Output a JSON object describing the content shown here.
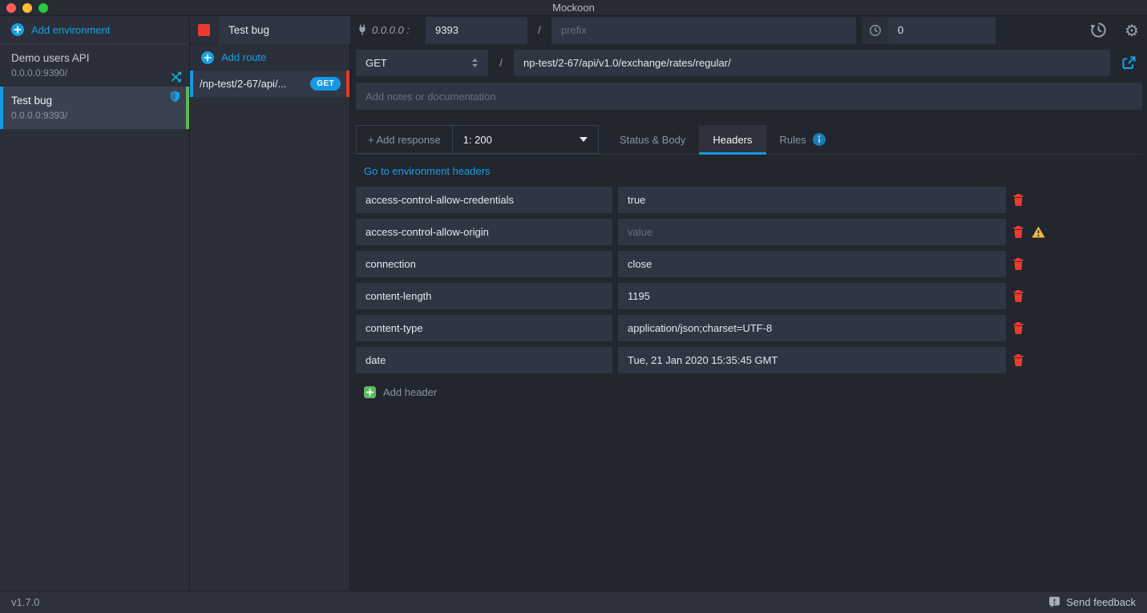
{
  "titlebar": {
    "title": "Mockoon"
  },
  "env_sidebar": {
    "add_environment_label": "Add environment",
    "items": [
      {
        "name": "Demo users API",
        "url": "0.0.0.0:9390/",
        "selected": false,
        "proxy_mode": true
      },
      {
        "name": "Test bug",
        "url": "0.0.0.0:9393/",
        "selected": true,
        "https": true,
        "running": true
      }
    ]
  },
  "routes_panel": {
    "environment_name": "Test bug",
    "add_route_label": "Add route",
    "route": {
      "path": "/np-test/2-67/api/...",
      "method": "GET",
      "selected": true
    }
  },
  "env_toolbar": {
    "host_label": "0.0.0.0 :",
    "port": "9393",
    "separator": "/",
    "prefix_placeholder": "prefix",
    "latency": "0"
  },
  "route_config": {
    "method": "GET",
    "separator": "/",
    "endpoint": "np-test/2-67/api/v1.0/exchange/rates/regular/",
    "notes_placeholder": "Add notes or documentation"
  },
  "response_section": {
    "add_response_label": "+ Add response",
    "selected_response": "1: 200",
    "tabs": [
      {
        "label": "Status & Body",
        "active": false
      },
      {
        "label": "Headers",
        "active": true
      },
      {
        "label": "Rules",
        "active": false,
        "has_info_icon": true
      }
    ],
    "go_to_env_headers_label": "Go to environment headers",
    "headers": [
      {
        "key": "access-control-allow-credentials",
        "value": "true",
        "value_placeholder": "",
        "warning": false
      },
      {
        "key": "access-control-allow-origin",
        "value": "",
        "value_placeholder": "value",
        "warning": true
      },
      {
        "key": "connection",
        "value": "close",
        "value_placeholder": "",
        "warning": false
      },
      {
        "key": "content-length",
        "value": "1195",
        "value_placeholder": "",
        "warning": false
      },
      {
        "key": "content-type",
        "value": "application/json;charset=UTF-8",
        "value_placeholder": "",
        "warning": false
      },
      {
        "key": "date",
        "value": "Tue, 21 Jan 2020 15:35:45 GMT",
        "value_placeholder": "",
        "warning": false
      }
    ],
    "add_header_label": "Add header"
  },
  "statusbar": {
    "version": "v1.7.0",
    "feedback_label": "Send feedback"
  },
  "colors": {
    "accent_blue": "#16a0e4",
    "running_green": "#5cb85c",
    "record_red": "#e93a2e",
    "warning_yellow": "#f6b73c"
  }
}
